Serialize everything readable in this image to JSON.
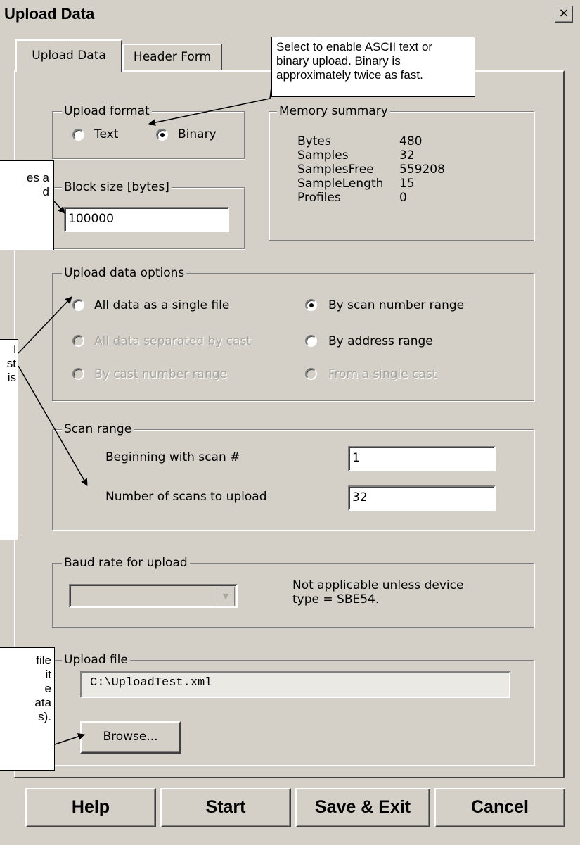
{
  "window": {
    "title": "Upload Data",
    "close_glyph": "×"
  },
  "tabs": [
    "Upload Data",
    "Header Form"
  ],
  "upload_format": {
    "label": "Upload format",
    "options": [
      "Text",
      "Binary"
    ],
    "selected": "Binary"
  },
  "memory_summary": {
    "label": "Memory summary",
    "rows": [
      {
        "key": "Bytes",
        "value": "480"
      },
      {
        "key": "Samples",
        "value": "32"
      },
      {
        "key": "SamplesFree",
        "value": "559208"
      },
      {
        "key": "SampleLength",
        "value": "15"
      },
      {
        "key": "Profiles",
        "value": "0"
      }
    ]
  },
  "block_size": {
    "label": "Block size [bytes]",
    "value": "100000"
  },
  "upload_options": {
    "label": "Upload data options",
    "options": [
      {
        "label": "All data as a single file",
        "selected": false,
        "enabled": true
      },
      {
        "label": "By scan number range",
        "selected": true,
        "enabled": true
      },
      {
        "label": "All data separated by cast",
        "selected": false,
        "enabled": false
      },
      {
        "label": "By address range",
        "selected": false,
        "enabled": true
      },
      {
        "label": "By cast number range",
        "selected": false,
        "enabled": false
      },
      {
        "label": "From a single cast",
        "selected": false,
        "enabled": false
      }
    ]
  },
  "scan_range": {
    "label": "Scan range",
    "begin_label": "Beginning with scan #",
    "begin_value": "1",
    "count_label": "Number of scans to upload",
    "count_value": "32"
  },
  "baud": {
    "label": "Baud rate for upload",
    "selected": "",
    "note_line1": "Not applicable unless device",
    "note_line2": "type = SBE54."
  },
  "upload_file": {
    "label": "Upload file",
    "path": "C:\\UploadTest.xml",
    "browse_label": "Browse..."
  },
  "buttons": {
    "help": "Help",
    "start": "Start",
    "save_exit": "Save & Exit",
    "cancel": "Cancel"
  },
  "callouts": {
    "format": [
      "Select to enable ASCII text or",
      "binary upload. Binary is",
      "approximately twice as fast."
    ],
    "block": [
      "es a",
      "",
      "d"
    ],
    "options": [
      "",
      "",
      "",
      "",
      "l",
      "",
      "",
      "st",
      "is"
    ],
    "file": [
      "",
      "file",
      "",
      "it",
      "e",
      "",
      "ata",
      "s)."
    ]
  },
  "icons": {
    "radio": "radio-button-icon",
    "dropdown": "chevron-down-icon",
    "close": "close-icon"
  }
}
